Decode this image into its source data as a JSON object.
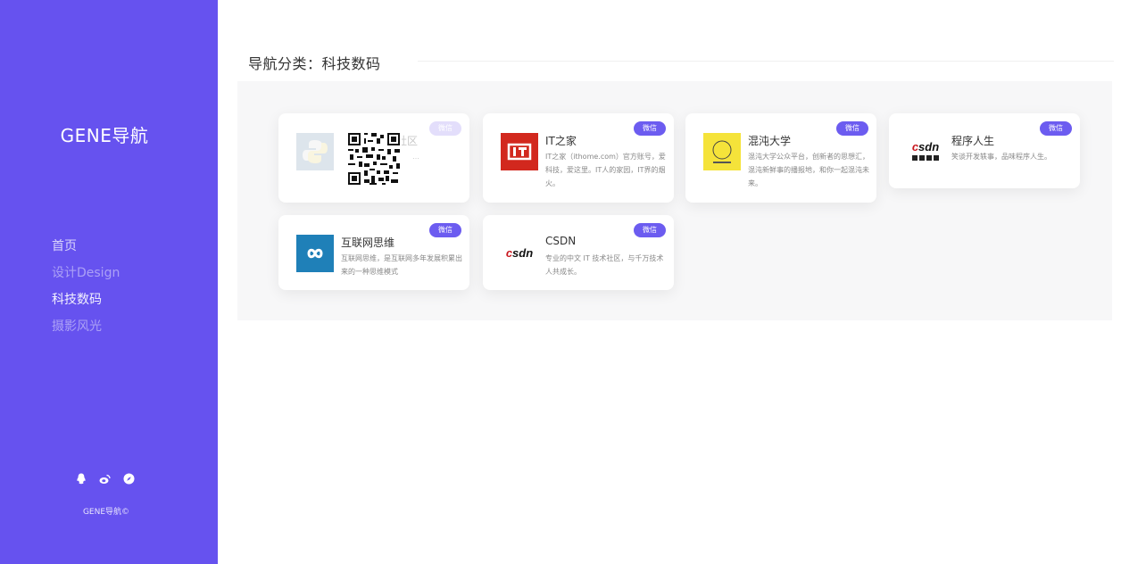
{
  "sidebar": {
    "brand": "GENE导航",
    "nav": [
      "首页",
      "设计Design",
      "科技数码",
      "摄影风光"
    ],
    "social_icons": [
      "qq-icon",
      "weibo-icon",
      "compass-icon"
    ],
    "footer": "GENE导航©"
  },
  "main": {
    "section_title": "导航分类：科技数码",
    "cards": [
      {
        "title": "…社区",
        "desc": "…",
        "badge": "微信",
        "logo": "python-icon",
        "faded": true
      },
      {
        "title": "IT之家",
        "desc": "IT之家（ithome.com）官方账号，爱科技，爱这里。IT人的家园，IT界的烟火。",
        "badge": "微信",
        "logo": "ithome-logo"
      },
      {
        "title": "混沌大学",
        "desc": "混沌大学公众平台，创新者的思想汇，混沌新鲜事的播报地，和你一起混沌未来。",
        "badge": "微信",
        "logo": "hundun-logo"
      },
      {
        "title": "程序人生",
        "desc": "笑谈开发轶事，品味程序人生。",
        "badge": "微信",
        "logo": "csdn-chengxu-logo"
      },
      {
        "title": "互联网思维",
        "desc": "互联网思维，是互联网多年发展积累出来的一种思维模式",
        "badge": "微信",
        "logo": "infinity-logo"
      },
      {
        "title": "CSDN",
        "desc": "专业的中文 IT 技术社区，与千万技术人共成长。",
        "badge": "微信",
        "logo": "csdn-logo"
      }
    ]
  }
}
